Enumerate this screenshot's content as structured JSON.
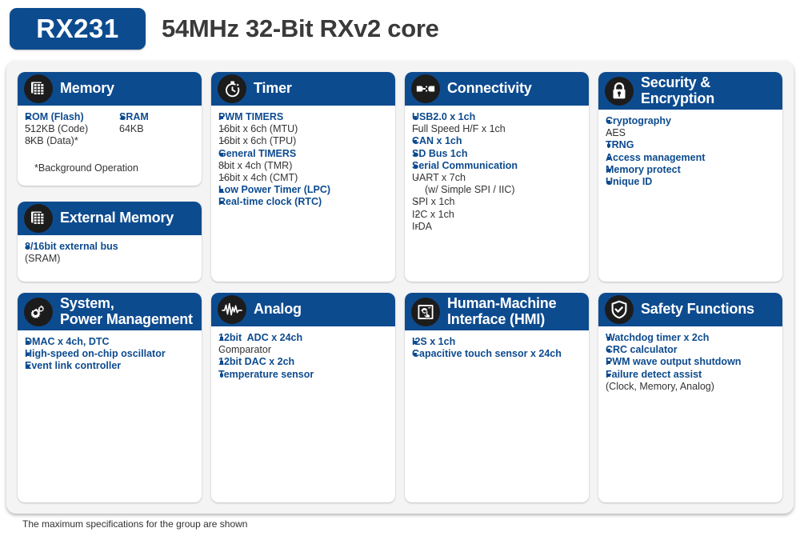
{
  "header": {
    "chip_name": "RX231",
    "title": "54MHz 32-Bit RXv2 core",
    "badge_color": "#0d4b8f"
  },
  "footer": {
    "note": "The maximum specifications for the group are shown"
  },
  "colors": {
    "header_blue": "#0d4b8f",
    "icon_circle": "#1c1c1c",
    "board_bg": "#f4f4f4",
    "panel_bg": "#ffffff",
    "title_text": "#3a3a3a",
    "body_text": "#333333"
  },
  "panels": {
    "memory": {
      "title": "Memory",
      "icon": "memory-grid-icon",
      "column_a": [
        {
          "level": 1,
          "text": "ROM (Flash)"
        },
        {
          "level": 2,
          "text": "512KB (Code)"
        },
        {
          "level": 2,
          "text": "8KB (Data)*"
        }
      ],
      "column_b": [
        {
          "level": 1,
          "text": "SRAM"
        },
        {
          "level": 0,
          "text": "64KB"
        }
      ],
      "note": "*Background Operation"
    },
    "external_memory": {
      "title": "External Memory",
      "icon": "memory-grid-icon",
      "items": [
        {
          "level": 1,
          "text": "8/16bit external bus"
        },
        {
          "level": 0,
          "text": "(SRAM)"
        }
      ]
    },
    "system_power": {
      "title_line1": "System,",
      "title_line2": "Power Management",
      "icon": "gears-icon",
      "items": [
        {
          "level": 1,
          "text": "DMAC x 4ch, DTC"
        },
        {
          "level": 1,
          "text": "High-speed on-chip oscillator"
        },
        {
          "level": 1,
          "text": "Event link controller"
        }
      ]
    },
    "timer": {
      "title": "Timer",
      "icon": "stopwatch-icon",
      "items": [
        {
          "level": 1,
          "text": "PWM TIMERS"
        },
        {
          "level": 2,
          "text": "16bit x 6ch (MTU)"
        },
        {
          "level": 2,
          "text": "16bit x 6ch (TPU)"
        },
        {
          "level": 1,
          "text": "General TIMERS"
        },
        {
          "level": 2,
          "text": "8bit x 4ch (TMR)"
        },
        {
          "level": 2,
          "text": "16bit x 4ch (CMT)"
        },
        {
          "level": 1,
          "text": "Low Power Timer (LPC)"
        },
        {
          "level": 1,
          "text": "Real-time clock (RTC)"
        }
      ]
    },
    "analog": {
      "title": "Analog",
      "icon": "waveform-icon",
      "items": [
        {
          "level": 1,
          "text": "12bit  ADC x 24ch"
        },
        {
          "level": 2,
          "text": "Comparator"
        },
        {
          "level": 1,
          "text": "12bit DAC x 2ch"
        },
        {
          "level": 1,
          "text": "Temperature sensor"
        }
      ]
    },
    "connectivity": {
      "title": "Connectivity",
      "icon": "plug-connector-icon",
      "items": [
        {
          "level": 1,
          "text": "USB2.0 x 1ch"
        },
        {
          "level": 2,
          "text": "Full Speed H/F x 1ch"
        },
        {
          "level": 1,
          "text": "CAN x 1ch"
        },
        {
          "level": 1,
          "text": "SD Bus 1ch"
        },
        {
          "level": 1,
          "text": "Serial Communication"
        },
        {
          "level": 2,
          "text": "UART x 7ch"
        },
        {
          "level": 0,
          "text": "(w/ Simple SPI / IIC)"
        },
        {
          "level": 2,
          "text": "SPI x 1ch"
        },
        {
          "level": 2,
          "text": "I2C x 1ch"
        },
        {
          "level": 2,
          "text": "IrDA"
        }
      ]
    },
    "hmi": {
      "title_line1": "Human-Machine",
      "title_line2": "Interface (HMI)",
      "icon": "touch-screen-icon",
      "items": [
        {
          "level": 1,
          "text": "I2S x 1ch"
        },
        {
          "level": 1,
          "text": "Capacitive touch sensor x 24ch"
        }
      ]
    },
    "security": {
      "title_line1": "Security &",
      "title_line2": "Encryption",
      "icon": "lock-icon",
      "items": [
        {
          "level": 1,
          "text": "Cryptography"
        },
        {
          "level": 2,
          "text": "AES"
        },
        {
          "level": 1,
          "text": "TRNG"
        },
        {
          "level": 1,
          "text": "Access management"
        },
        {
          "level": 1,
          "text": "Memory protect"
        },
        {
          "level": 1,
          "text": "Unique ID"
        }
      ]
    },
    "safety": {
      "title": "Safety Functions",
      "icon": "shield-check-icon",
      "items": [
        {
          "level": 1,
          "text": "Watchdog timer x 2ch"
        },
        {
          "level": 1,
          "text": "CRC calculator"
        },
        {
          "level": 1,
          "text": "PWM wave output shutdown"
        },
        {
          "level": 1,
          "text": "Failure detect assist"
        },
        {
          "level": 0,
          "text": "(Clock, Memory, Analog)"
        }
      ]
    }
  }
}
